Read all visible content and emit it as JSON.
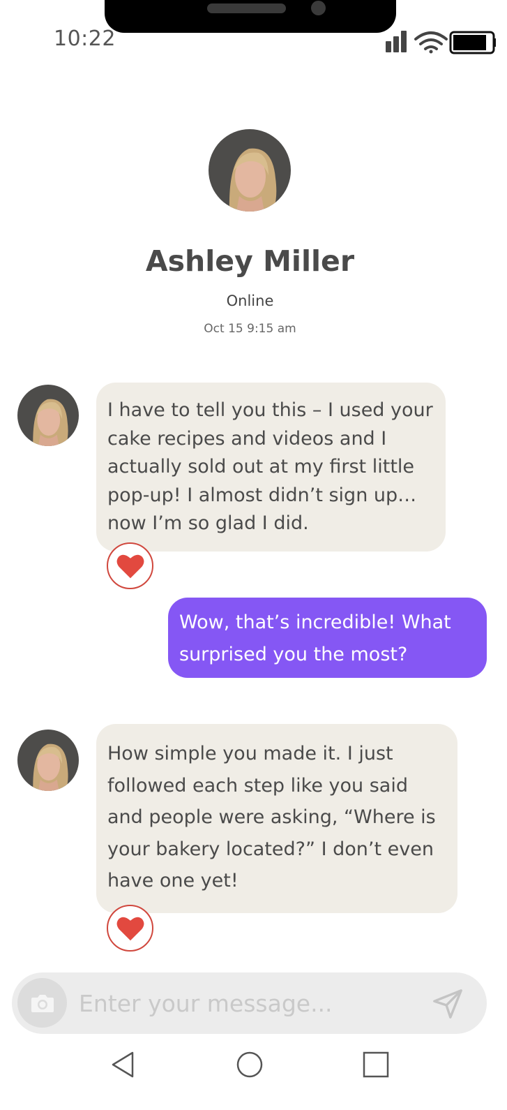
{
  "status_bar": {
    "time": "10:22",
    "icons": [
      "signal-icon",
      "wifi-icon",
      "battery-icon"
    ]
  },
  "contact": {
    "name": "Ashley Miller",
    "status": "Online",
    "last_seen": "Oct 15 9:15 am"
  },
  "messages": [
    {
      "direction": "incoming",
      "text": "I have to tell you this – I used your cake recipes and videos and I actually sold out at my first little pop-up! I almost didn’t sign up… now I’m so glad I did.",
      "reaction": "heart-icon"
    },
    {
      "direction": "outgoing",
      "text": "Wow, that’s incredible! What surprised you the most?"
    },
    {
      "direction": "incoming",
      "text": "How simple you made it. I just followed each step like you said and people were asking, “Where is your bakery located?” I don’t even have one yet!",
      "reaction": "heart-icon"
    }
  ],
  "composer": {
    "placeholder": "Enter your message...",
    "value": ""
  },
  "colors": {
    "outgoing_bubble": "#8557f4",
    "incoming_bubble": "#f0ede6",
    "heart": "#e2493f"
  }
}
